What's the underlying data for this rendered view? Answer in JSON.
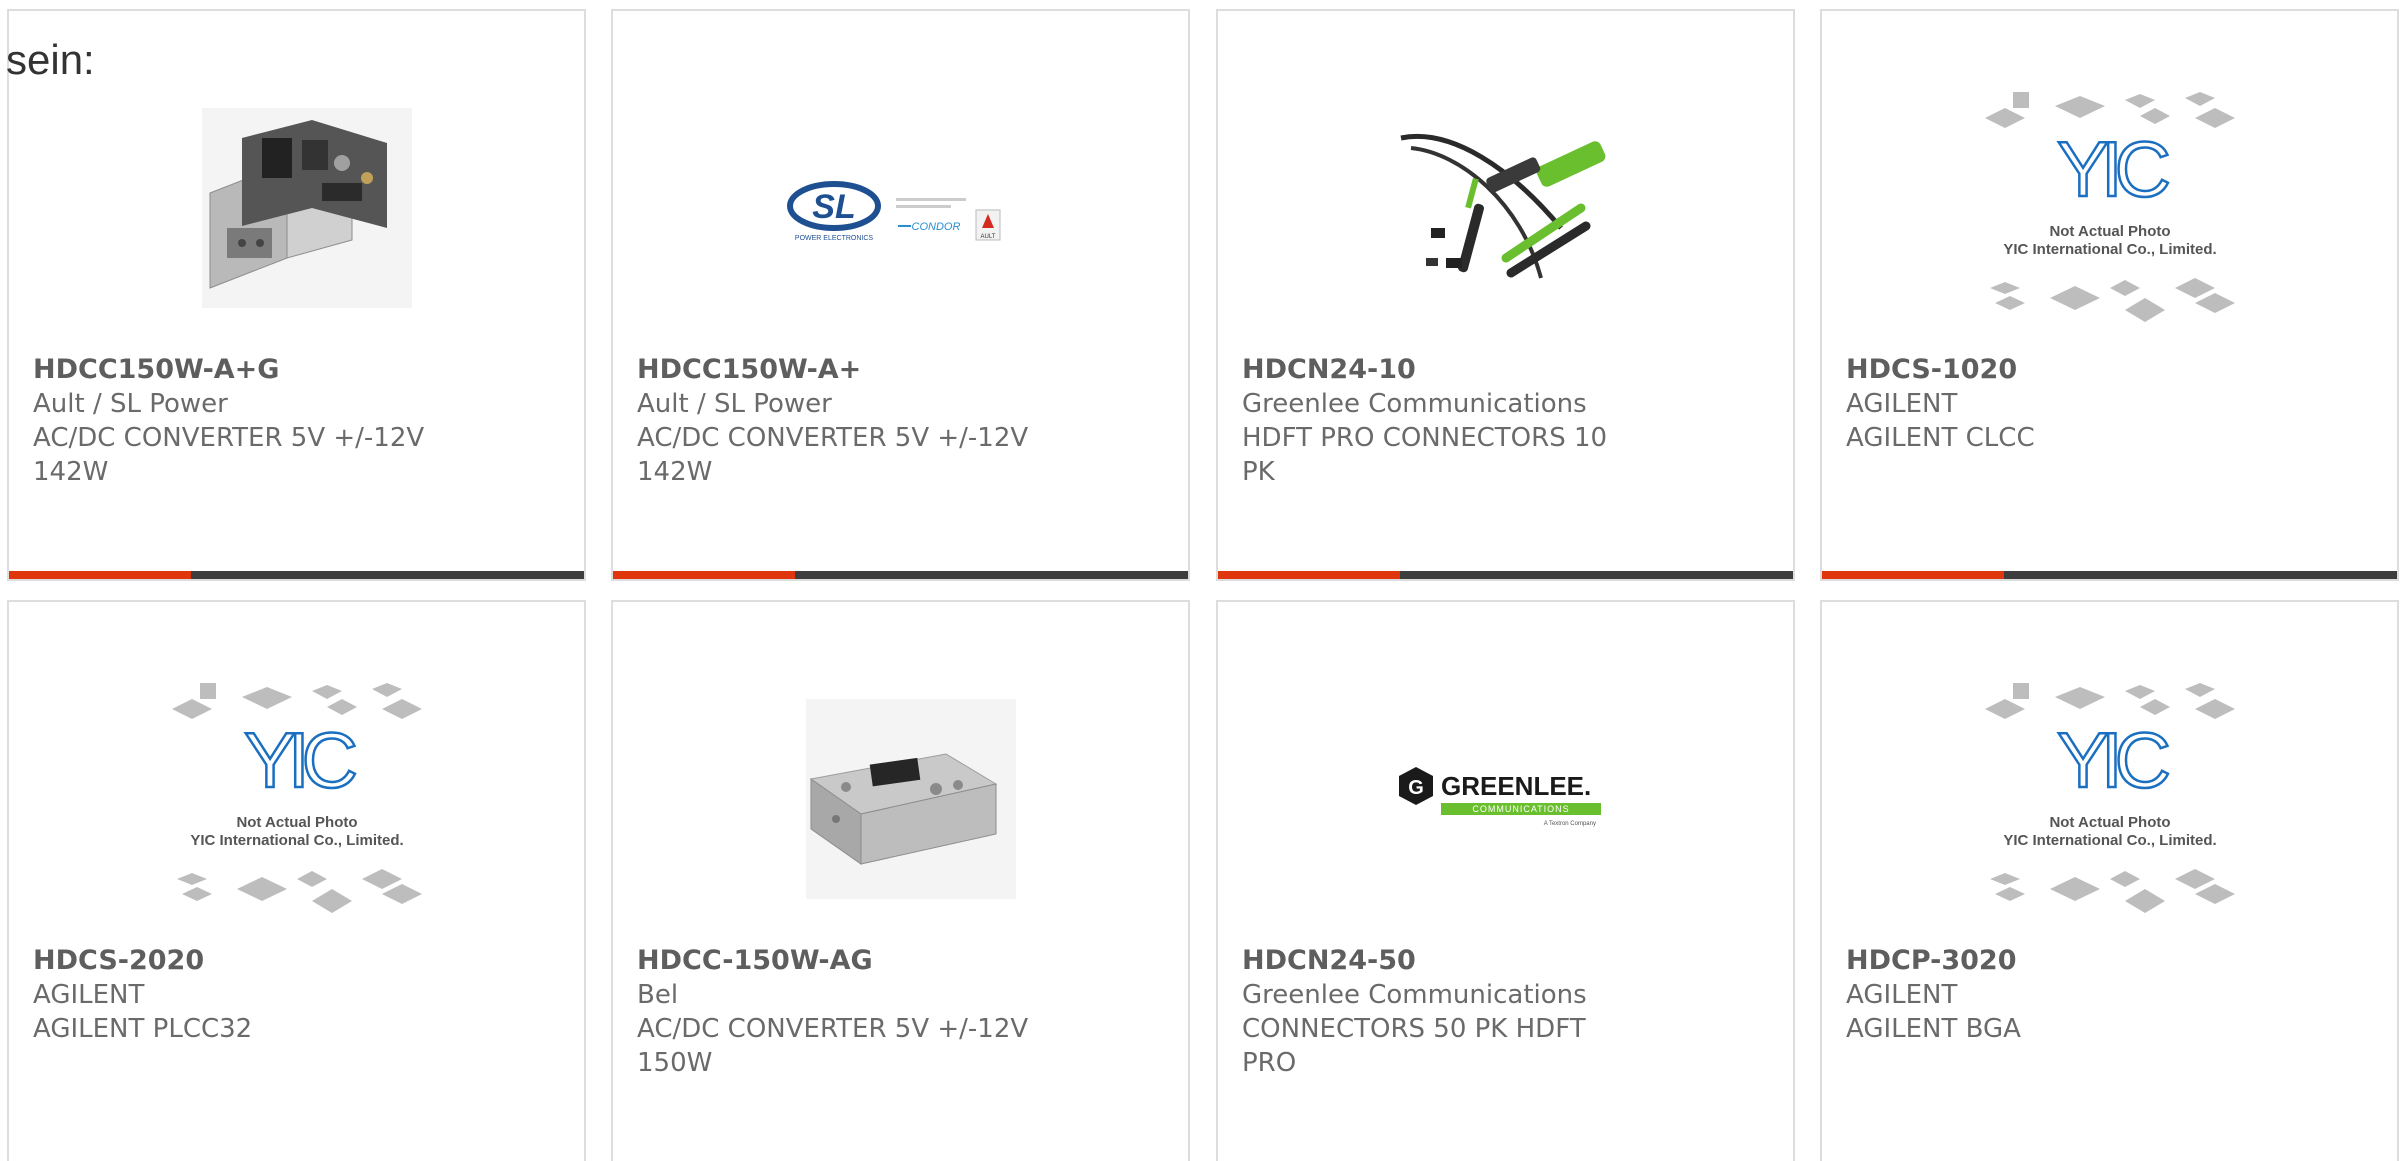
{
  "intro_fragment": "sein:",
  "colors": {
    "accent_bar": "#e0360e",
    "dark_bar": "#3d3d3d",
    "card_border": "#dddddd",
    "text": "#6a6a6a",
    "yic_logo": "#1a6fc0",
    "greenlee_green": "#6abf2e"
  },
  "products": [
    {
      "part_number": "HDCC150W-A+G",
      "manufacturer": "Ault / SL Power",
      "description": "AC/DC CONVERTER 5V +/-12V 142W",
      "image": "power-supply-open-chassis"
    },
    {
      "part_number": "HDCC150W-A+",
      "manufacturer": "Ault / SL Power",
      "description": "AC/DC CONVERTER 5V +/-12V 142W",
      "image": "sl-power-logo",
      "logo_text": "SL",
      "logo_small": "POWER ELECTRONICS",
      "logo_condor": "CONDOR",
      "logo_ault": "AULT"
    },
    {
      "part_number": "HDCN24-10",
      "manufacturer": "Greenlee Communications",
      "description": "HDFT PRO CONNECTORS 10 PK",
      "image": "crimp-tool-kit"
    },
    {
      "part_number": "HDCS-1020",
      "manufacturer": "AGILENT",
      "description": "AGILENT CLCC",
      "image": "yic-placeholder",
      "placeholder_line1": "Not Actual Photo",
      "placeholder_line2": "YIC International Co., Limited."
    },
    {
      "part_number": "HDCS-2020",
      "manufacturer": "AGILENT",
      "description": "AGILENT PLCC32",
      "image": "yic-placeholder",
      "placeholder_line1": "Not Actual Photo",
      "placeholder_line2": "YIC International Co., Limited."
    },
    {
      "part_number": "HDCC-150W-AG",
      "manufacturer": "Bel",
      "description": "AC/DC CONVERTER 5V +/-12V 150W",
      "image": "power-supply-closed-chassis"
    },
    {
      "part_number": "HDCN24-50",
      "manufacturer": "Greenlee Communications",
      "description": "CONNECTORS 50 PK HDFT PRO",
      "image": "greenlee-logo",
      "logo_text": "GREENLEE.",
      "logo_sub": "COMMUNICATIONS",
      "logo_tag": "A Textron Company"
    },
    {
      "part_number": "HDCP-3020",
      "manufacturer": "AGILENT",
      "description": "AGILENT BGA",
      "image": "yic-placeholder",
      "placeholder_line1": "Not Actual Photo",
      "placeholder_line2": "YIC International Co., Limited."
    }
  ]
}
